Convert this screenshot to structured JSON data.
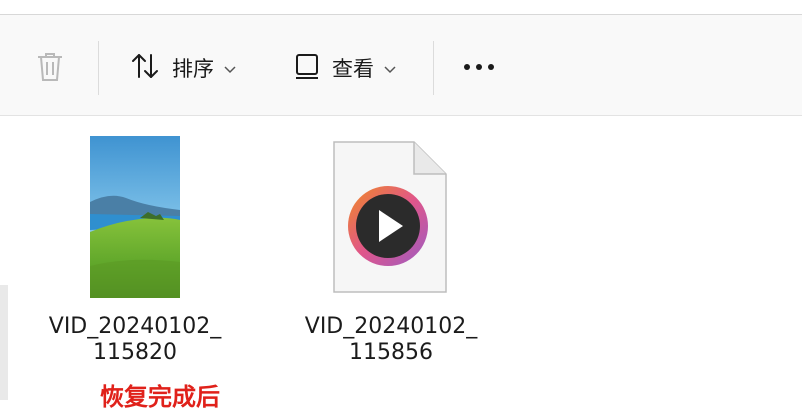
{
  "toolbar": {
    "sort_label": "排序",
    "view_label": "查看",
    "more_label": "•••"
  },
  "files": [
    {
      "name_line1": "VID_20240102_",
      "name_line2": "115820",
      "type": "video-thumbnail"
    },
    {
      "name_line1": "VID_20240102_",
      "name_line2": "115856",
      "type": "video-file-icon"
    }
  ],
  "caption": "恢复完成后",
  "colors": {
    "caption": "#e0211a",
    "play_ring_start": "#f08a24",
    "play_ring_end": "#9b5cc4"
  }
}
